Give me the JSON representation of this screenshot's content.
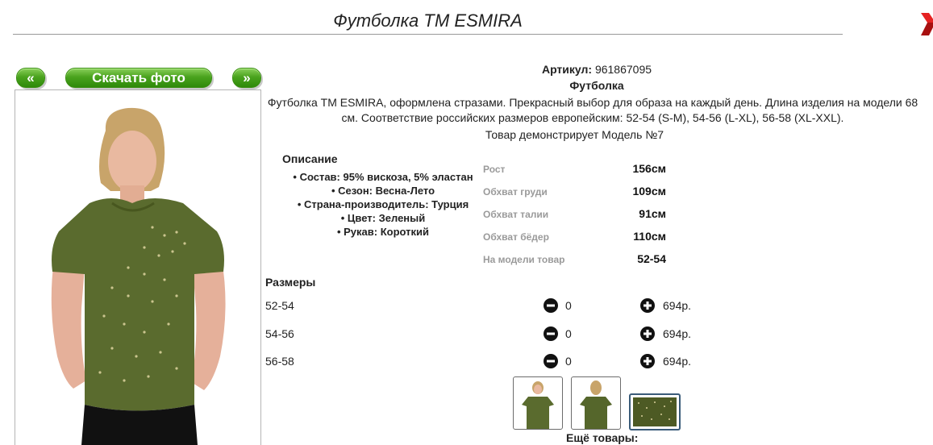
{
  "header": {
    "title": "Футболка ТМ ESMIRA"
  },
  "gallery": {
    "prev_label": "«",
    "download_label": "Скачать фото",
    "next_label": "»"
  },
  "product": {
    "article_label": "Артикул:",
    "article_value": "961867095",
    "type": "Футболка",
    "description": "Футболка ТМ ESMIRA, оформлена стразами. Прекрасный выбор для образа на каждый день. Длина изделия на модели 68 см. Соответствие российских размеров европейским: 52-54 (S-M), 54-56 (L-XL), 56-58 (XL-XXL).",
    "model_note": "Товар демонстрирует Модель №7"
  },
  "details": {
    "heading": "Описание",
    "items": [
      "Состав: 95% вискоза, 5% эластан",
      "Сезон: Весна-Лето",
      "Страна-производитель: Турция",
      "Цвет: Зеленый",
      "Рукав: Короткий"
    ]
  },
  "measurements": [
    {
      "label": "Рост",
      "value": "156см"
    },
    {
      "label": "Обхват груди",
      "value": "109см"
    },
    {
      "label": "Обхват талии",
      "value": "91см"
    },
    {
      "label": "Обхват бёдер",
      "value": "110см"
    },
    {
      "label": "На модели товар",
      "value": "52-54"
    }
  ],
  "sizes": {
    "heading": "Размеры",
    "rows": [
      {
        "size": "52-54",
        "qty": "0",
        "price": "694р."
      },
      {
        "size": "54-56",
        "qty": "0",
        "price": "694р."
      },
      {
        "size": "56-58",
        "qty": "0",
        "price": "694р."
      }
    ]
  },
  "footer": {
    "more_label": "Ещё товары:"
  },
  "colors": {
    "accent_green": "#4aa31e",
    "shirt_olive": "#5a6b2e",
    "close_red": "#d21a1a"
  },
  "icons": [
    "close-icon",
    "minus-circle-icon",
    "plus-circle-icon"
  ]
}
